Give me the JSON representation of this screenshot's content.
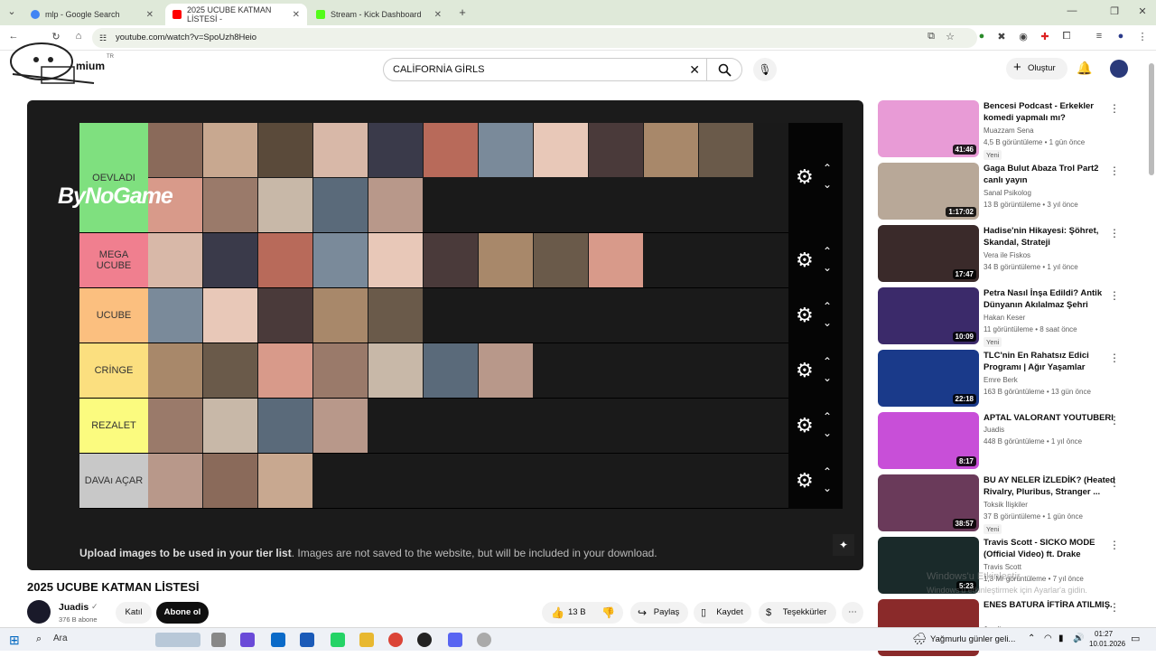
{
  "browser": {
    "tabs": [
      {
        "label": "mlp - Google Search",
        "active": false,
        "color": "#4285f4"
      },
      {
        "label": "2025 UCUBE KATMAN LİSTESİ -",
        "active": true,
        "color": "#ff0000"
      },
      {
        "label": "Stream - Kick Dashboard",
        "active": false,
        "color": "#53fc18"
      }
    ],
    "url": "youtube.com/watch?v=SpoUzh8Heio",
    "new_tab": "+"
  },
  "header": {
    "logo_text": "mium",
    "logo_sup": "TR",
    "search_value": "CALİFORNİA GİRLS",
    "create_label": "Oluştur"
  },
  "player": {
    "overlay_brand": "ByNoGame",
    "tiers": [
      {
        "label": "OEVLADI",
        "color": "#7fe07f",
        "tiles": 16
      },
      {
        "label": "MEGA\nUCUBE",
        "color": "#f07f8f",
        "tiles": 9
      },
      {
        "label": "UCUBE",
        "color": "#fbbf7f",
        "tiles": 5
      },
      {
        "label": "CRİNGE",
        "color": "#fbdf7f",
        "tiles": 7
      },
      {
        "label": "REZALET",
        "color": "#fbfb7f",
        "tiles": 4
      },
      {
        "label": "DAVAı AÇAR",
        "color": "#c8c8c8",
        "tiles": 3
      }
    ],
    "upload_bold": "Upload images to be used in your tier list",
    "upload_rest": ". Images are not saved to the website, but will be included in your download."
  },
  "video": {
    "title": "2025 UCUBE KATMAN LİSTESİ",
    "channel": "Juadis",
    "subscribers": "376 B abone",
    "join": "Katıl",
    "subscribe": "Abone ol",
    "likes": "13 B",
    "share": "Paylaş",
    "save": "Kaydet",
    "thanks": "Teşekkürler"
  },
  "sidebar": [
    {
      "title": "Bencesi Podcast - Erkekler komedi yapmalı mı?",
      "channel": "Muazzam Sena",
      "meta": "4,5 B görüntüleme • 1 gün önce",
      "new": "Yeni",
      "duration": "41:46",
      "color": "#e89bd6"
    },
    {
      "title": "Gaga Bulut Abaza Trol Part2 canlı yayın",
      "channel": "Sanal Psikolog",
      "meta": "13 B görüntüleme • 3 yıl önce",
      "new": "",
      "duration": "1:17:02",
      "color": "#b8a898"
    },
    {
      "title": "Hadise'nin Hikayesi: Şöhret, Skandal, Strateji",
      "channel": "Vera ile Fiskos",
      "meta": "34 B görüntüleme • 1 yıl önce",
      "new": "",
      "duration": "17:47",
      "color": "#3a2a2a"
    },
    {
      "title": "Petra Nasıl İnşa Edildi? Antik Dünyanın Akılalmaz Şehri",
      "channel": "Hakan Keser",
      "meta": "11 görüntüleme • 8 saat önce",
      "new": "Yeni",
      "duration": "10:09",
      "color": "#3b2a6a"
    },
    {
      "title": "TLC'nin En Rahatsız Edici Programı | Ağır Yaşamlar",
      "channel": "Emre Berk",
      "meta": "163 B görüntüleme • 13 gün önce",
      "new": "",
      "duration": "22:18",
      "color": "#1a3a8a"
    },
    {
      "title": "APTAL VALORANT YOUTUBERI",
      "channel": "Juadis",
      "meta": "448 B görüntüleme • 1 yıl önce",
      "new": "",
      "duration": "8:17",
      "color": "#c84fd8"
    },
    {
      "title": "BU AY NELER İZLEDİK? (Heated Rivalry, Pluribus, Stranger ...",
      "channel": "Toksik İlişkiler",
      "meta": "37 B görüntüleme • 1 gün önce",
      "new": "Yeni",
      "duration": "38:57",
      "color": "#6a3a5a"
    },
    {
      "title": "Travis Scott - SICKO MODE (Official Video) ft. Drake",
      "channel": "Travis Scott",
      "meta": "1,3 Mr görüntüleme • 7 yıl önce",
      "new": "",
      "duration": "5:23",
      "color": "#1a2a2a"
    },
    {
      "title": "ENES BATURA İFTİRA ATILMIŞ.",
      "channel": "Juadis",
      "meta": "",
      "new": "",
      "duration": "",
      "color": "#8a2a2a"
    }
  ],
  "watermark": {
    "line1": "Windows'u Etkinleştir",
    "line2": "Windows'u etkinleştirmek için Ayarlar'a gidin."
  },
  "taskbar": {
    "search_label": "Ara",
    "weather": "Yağmurlu günler geli...",
    "time": "01:27",
    "date": "10.01.2026"
  }
}
